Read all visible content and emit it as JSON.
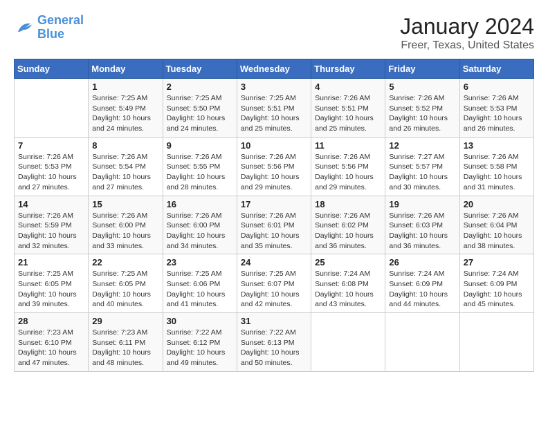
{
  "logo": {
    "line1": "General",
    "line2": "Blue"
  },
  "title": "January 2024",
  "subtitle": "Freer, Texas, United States",
  "days_header": [
    "Sunday",
    "Monday",
    "Tuesday",
    "Wednesday",
    "Thursday",
    "Friday",
    "Saturday"
  ],
  "weeks": [
    [
      {
        "num": "",
        "info": ""
      },
      {
        "num": "1",
        "info": "Sunrise: 7:25 AM\nSunset: 5:49 PM\nDaylight: 10 hours\nand 24 minutes."
      },
      {
        "num": "2",
        "info": "Sunrise: 7:25 AM\nSunset: 5:50 PM\nDaylight: 10 hours\nand 24 minutes."
      },
      {
        "num": "3",
        "info": "Sunrise: 7:25 AM\nSunset: 5:51 PM\nDaylight: 10 hours\nand 25 minutes."
      },
      {
        "num": "4",
        "info": "Sunrise: 7:26 AM\nSunset: 5:51 PM\nDaylight: 10 hours\nand 25 minutes."
      },
      {
        "num": "5",
        "info": "Sunrise: 7:26 AM\nSunset: 5:52 PM\nDaylight: 10 hours\nand 26 minutes."
      },
      {
        "num": "6",
        "info": "Sunrise: 7:26 AM\nSunset: 5:53 PM\nDaylight: 10 hours\nand 26 minutes."
      }
    ],
    [
      {
        "num": "7",
        "info": "Sunrise: 7:26 AM\nSunset: 5:53 PM\nDaylight: 10 hours\nand 27 minutes."
      },
      {
        "num": "8",
        "info": "Sunrise: 7:26 AM\nSunset: 5:54 PM\nDaylight: 10 hours\nand 27 minutes."
      },
      {
        "num": "9",
        "info": "Sunrise: 7:26 AM\nSunset: 5:55 PM\nDaylight: 10 hours\nand 28 minutes."
      },
      {
        "num": "10",
        "info": "Sunrise: 7:26 AM\nSunset: 5:56 PM\nDaylight: 10 hours\nand 29 minutes."
      },
      {
        "num": "11",
        "info": "Sunrise: 7:26 AM\nSunset: 5:56 PM\nDaylight: 10 hours\nand 29 minutes."
      },
      {
        "num": "12",
        "info": "Sunrise: 7:27 AM\nSunset: 5:57 PM\nDaylight: 10 hours\nand 30 minutes."
      },
      {
        "num": "13",
        "info": "Sunrise: 7:26 AM\nSunset: 5:58 PM\nDaylight: 10 hours\nand 31 minutes."
      }
    ],
    [
      {
        "num": "14",
        "info": "Sunrise: 7:26 AM\nSunset: 5:59 PM\nDaylight: 10 hours\nand 32 minutes."
      },
      {
        "num": "15",
        "info": "Sunrise: 7:26 AM\nSunset: 6:00 PM\nDaylight: 10 hours\nand 33 minutes."
      },
      {
        "num": "16",
        "info": "Sunrise: 7:26 AM\nSunset: 6:00 PM\nDaylight: 10 hours\nand 34 minutes."
      },
      {
        "num": "17",
        "info": "Sunrise: 7:26 AM\nSunset: 6:01 PM\nDaylight: 10 hours\nand 35 minutes."
      },
      {
        "num": "18",
        "info": "Sunrise: 7:26 AM\nSunset: 6:02 PM\nDaylight: 10 hours\nand 36 minutes."
      },
      {
        "num": "19",
        "info": "Sunrise: 7:26 AM\nSunset: 6:03 PM\nDaylight: 10 hours\nand 36 minutes."
      },
      {
        "num": "20",
        "info": "Sunrise: 7:26 AM\nSunset: 6:04 PM\nDaylight: 10 hours\nand 38 minutes."
      }
    ],
    [
      {
        "num": "21",
        "info": "Sunrise: 7:25 AM\nSunset: 6:05 PM\nDaylight: 10 hours\nand 39 minutes."
      },
      {
        "num": "22",
        "info": "Sunrise: 7:25 AM\nSunset: 6:05 PM\nDaylight: 10 hours\nand 40 minutes."
      },
      {
        "num": "23",
        "info": "Sunrise: 7:25 AM\nSunset: 6:06 PM\nDaylight: 10 hours\nand 41 minutes."
      },
      {
        "num": "24",
        "info": "Sunrise: 7:25 AM\nSunset: 6:07 PM\nDaylight: 10 hours\nand 42 minutes."
      },
      {
        "num": "25",
        "info": "Sunrise: 7:24 AM\nSunset: 6:08 PM\nDaylight: 10 hours\nand 43 minutes."
      },
      {
        "num": "26",
        "info": "Sunrise: 7:24 AM\nSunset: 6:09 PM\nDaylight: 10 hours\nand 44 minutes."
      },
      {
        "num": "27",
        "info": "Sunrise: 7:24 AM\nSunset: 6:09 PM\nDaylight: 10 hours\nand 45 minutes."
      }
    ],
    [
      {
        "num": "28",
        "info": "Sunrise: 7:23 AM\nSunset: 6:10 PM\nDaylight: 10 hours\nand 47 minutes."
      },
      {
        "num": "29",
        "info": "Sunrise: 7:23 AM\nSunset: 6:11 PM\nDaylight: 10 hours\nand 48 minutes."
      },
      {
        "num": "30",
        "info": "Sunrise: 7:22 AM\nSunset: 6:12 PM\nDaylight: 10 hours\nand 49 minutes."
      },
      {
        "num": "31",
        "info": "Sunrise: 7:22 AM\nSunset: 6:13 PM\nDaylight: 10 hours\nand 50 minutes."
      },
      {
        "num": "",
        "info": ""
      },
      {
        "num": "",
        "info": ""
      },
      {
        "num": "",
        "info": ""
      }
    ]
  ]
}
